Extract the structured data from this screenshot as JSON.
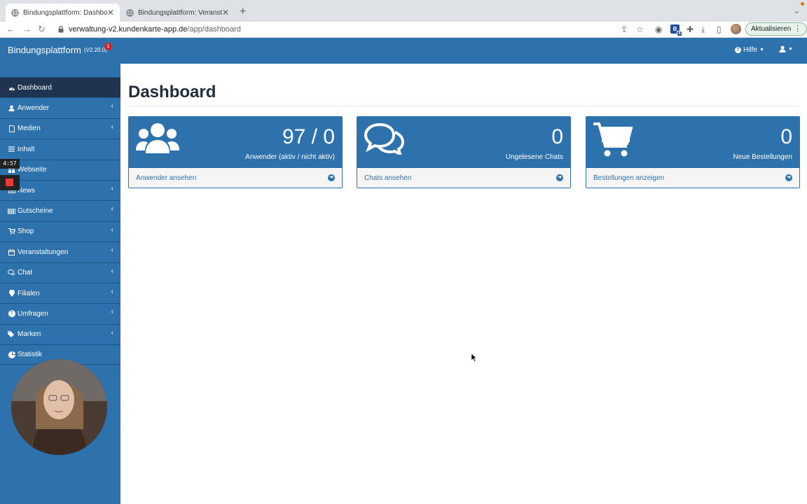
{
  "browser": {
    "tabs": [
      {
        "title": "Bindungsplattform: Dashboard",
        "active": true
      },
      {
        "title": "Bindungsplattform: Veranstaltu",
        "active": false
      }
    ],
    "url_domain": "verwaltung-v2.kundenkarte-app.de",
    "url_path": "/app/dashboard",
    "extension_badge_count": "4",
    "update_button": "Aktualisieren"
  },
  "header": {
    "brand": "Bindungsplattform",
    "version": "(V2.20.0)",
    "notification_count": "1",
    "help_label": "Hilfe"
  },
  "sidebar": {
    "items": [
      {
        "label": "Dashboard",
        "icon": "dashboard-icon",
        "active": true,
        "has_submenu": false
      },
      {
        "label": "Anwender",
        "icon": "user-icon",
        "active": false,
        "has_submenu": true
      },
      {
        "label": "Medien",
        "icon": "file-icon",
        "active": false,
        "has_submenu": true
      },
      {
        "label": "Inhalt",
        "icon": "list-icon",
        "active": false,
        "has_submenu": false
      },
      {
        "label": "Webseite",
        "icon": "grid-icon",
        "active": false,
        "has_submenu": false
      },
      {
        "label": "News",
        "icon": "news-icon",
        "active": false,
        "has_submenu": true
      },
      {
        "label": "Gutscheine",
        "icon": "barcode-icon",
        "active": false,
        "has_submenu": true
      },
      {
        "label": "Shop",
        "icon": "cart-icon",
        "active": false,
        "has_submenu": true
      },
      {
        "label": "Veranstaltungen",
        "icon": "calendar-icon",
        "active": false,
        "has_submenu": true
      },
      {
        "label": "Chat",
        "icon": "chat-icon",
        "active": false,
        "has_submenu": true
      },
      {
        "label": "Filialen",
        "icon": "map-pin-icon",
        "active": false,
        "has_submenu": true
      },
      {
        "label": "Umfragen",
        "icon": "question-icon",
        "active": false,
        "has_submenu": true
      },
      {
        "label": "Marken",
        "icon": "tags-icon",
        "active": false,
        "has_submenu": true
      },
      {
        "label": "Statistik",
        "icon": "pie-chart-icon",
        "active": false,
        "has_submenu": false
      }
    ]
  },
  "overlay": {
    "timer": "4:57"
  },
  "main": {
    "title": "Dashboard",
    "cards": [
      {
        "value": "97 / 0",
        "label": "Anwender (aktiv / nicht aktiv)",
        "link": "Anwender ansehen",
        "icon": "users-icon"
      },
      {
        "value": "0",
        "label": "Ungelesene Chats",
        "link": "Chats ansehen",
        "icon": "comments-icon"
      },
      {
        "value": "0",
        "label": "Neue Bestellungen",
        "link": "Bestellungen anzeigen",
        "icon": "shopping-cart-icon"
      }
    ]
  },
  "colors": {
    "primary": "#2d72ad",
    "sidebar_active": "#1f3450",
    "badge_red": "#d9232d"
  }
}
